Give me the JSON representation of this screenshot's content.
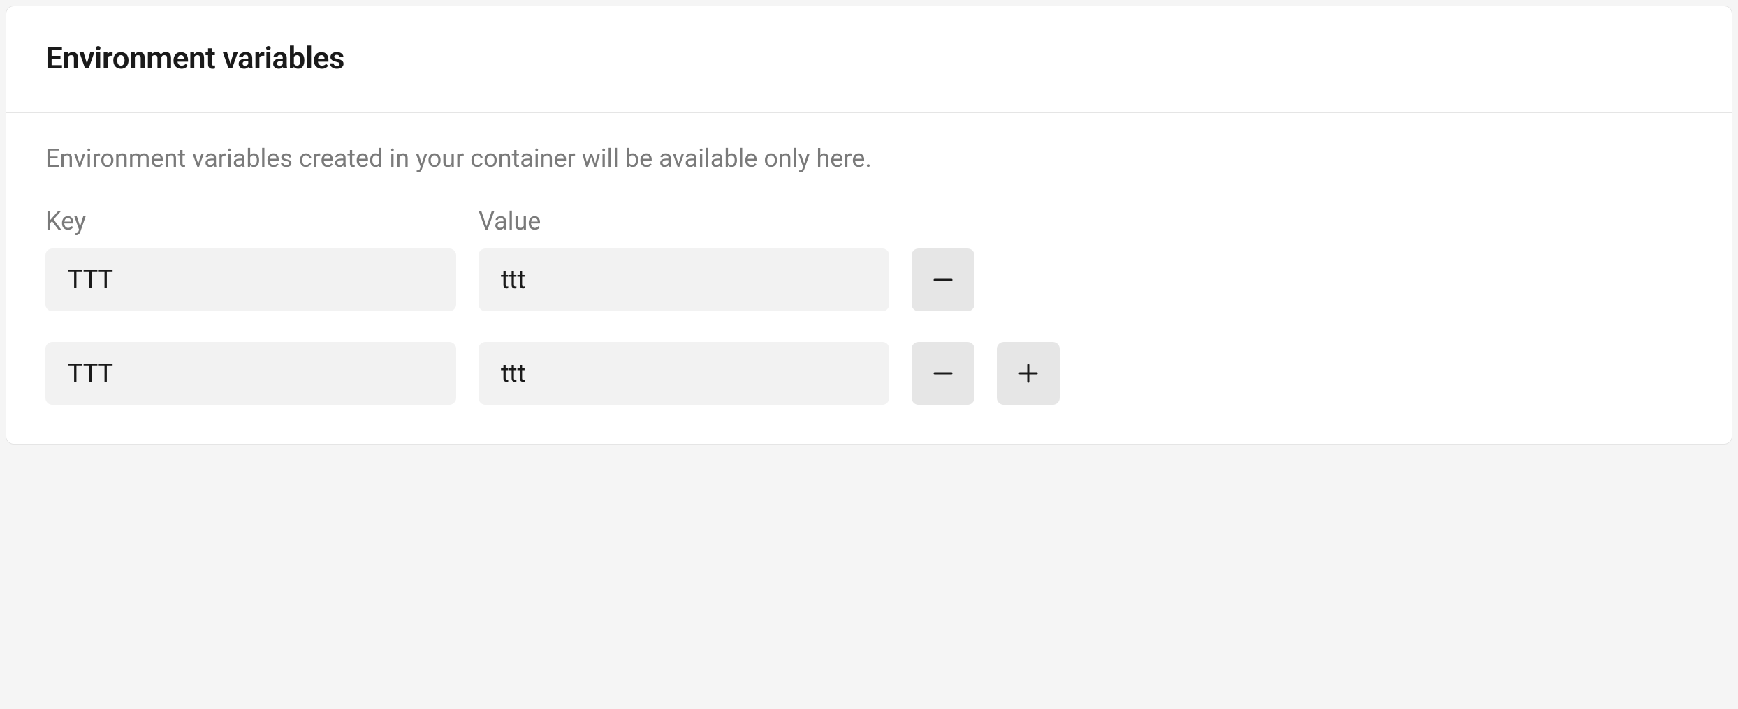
{
  "header": {
    "title": "Environment variables"
  },
  "body": {
    "description": "Environment variables created in your container will be available only here.",
    "columns": {
      "key_label": "Key",
      "value_label": "Value"
    },
    "rows": [
      {
        "key": "TTT",
        "value": "ttt",
        "has_add": false
      },
      {
        "key": "TTT",
        "value": "ttt",
        "has_add": true
      }
    ]
  }
}
